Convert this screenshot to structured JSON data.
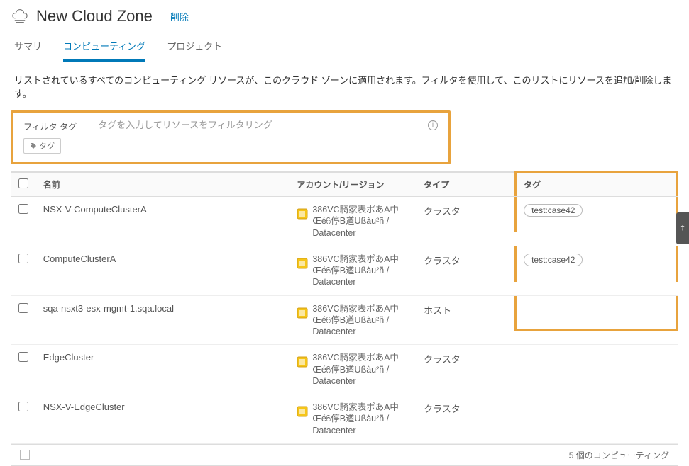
{
  "header": {
    "title": "New Cloud Zone",
    "delete_link": "削除"
  },
  "tabs": {
    "summary": "サマリ",
    "computing": "コンピューティング",
    "project": "プロジェクト"
  },
  "description": "リストされているすべてのコンピューティング リソースが、このクラウド ゾーンに適用されます。フィルタを使用して、このリストにリソースを追加/削除します。",
  "filter": {
    "label": "フィルタ タグ",
    "placeholder": "タグを入力してリソースをフィルタリング",
    "tags_button": "タグ"
  },
  "table": {
    "headers": {
      "name": "名前",
      "account": "アカウント/リージョン",
      "type": "タイプ",
      "tags": "タグ"
    },
    "rows": [
      {
        "name": "NSX-V-ComputeClusterA",
        "account": "386VC騎家表ポあA中Œéᦆ停B遒Ußàu²ñ / Datacenter",
        "type": "クラスタ",
        "tag": "test:case42",
        "highlighted": true
      },
      {
        "name": "ComputeClusterA",
        "account": "386VC騎家表ポあA中Œéᦆ停B遒Ußàu²ñ / Datacenter",
        "type": "クラスタ",
        "tag": "test:case42",
        "highlighted": true
      },
      {
        "name": "sqa-nsxt3-esx-mgmt-1.sqa.local",
        "account": "386VC騎家表ポあA中Œéᦆ停B遒Ußàu²ñ / Datacenter",
        "type": "ホスト",
        "tag": null,
        "highlighted": true
      },
      {
        "name": "EdgeCluster",
        "account": "386VC騎家表ポあA中Œéᦆ停B遒Ußàu²ñ / Datacenter",
        "type": "クラスタ",
        "tag": null,
        "highlighted": false
      },
      {
        "name": "NSX-V-EdgeCluster",
        "account": "386VC騎家表ポあA中Œéᦆ停B遒Ußàu²ñ / Datacenter",
        "type": "クラスタ",
        "tag": null,
        "highlighted": false
      }
    ]
  },
  "footer": {
    "count_text": "5 個のコンピューティング"
  }
}
